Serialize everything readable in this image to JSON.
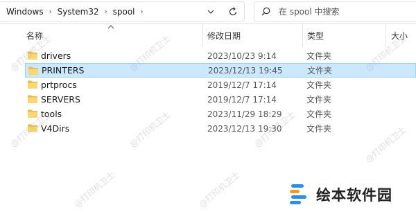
{
  "breadcrumb": [
    "Windows",
    "System32",
    "spool"
  ],
  "search": {
    "placeholder": "在 spool 中搜索"
  },
  "columns": {
    "name": "名称",
    "date": "修改日期",
    "type": "类型",
    "size": "大小"
  },
  "files": [
    {
      "name": "drivers",
      "date": "2023/10/23 9:14",
      "type": "文件夹",
      "selected": false
    },
    {
      "name": "PRINTERS",
      "date": "2023/12/13 19:45",
      "type": "文件夹",
      "selected": true
    },
    {
      "name": "prtprocs",
      "date": "2019/12/7 17:14",
      "type": "文件夹",
      "selected": false
    },
    {
      "name": "SERVERS",
      "date": "2019/12/7 17:14",
      "type": "文件夹",
      "selected": false
    },
    {
      "name": "tools",
      "date": "2023/11/29 18:29",
      "type": "文件夹",
      "selected": false
    },
    {
      "name": "V4Dirs",
      "date": "2023/12/13 19:30",
      "type": "文件夹",
      "selected": false
    }
  ],
  "watermark": "@打印机卫士",
  "logo_text": "绘本软件园",
  "colors": {
    "selection_bg": "#cce8ff",
    "selection_border": "#99d1ff",
    "folder": "#f8d775",
    "logo_blue": "#2b8ee8",
    "logo_orange": "#f39a1e"
  },
  "icons": [
    "chevron-right-icon",
    "chevron-down-icon",
    "refresh-icon",
    "search-icon",
    "sort-up-icon",
    "folder-icon"
  ]
}
